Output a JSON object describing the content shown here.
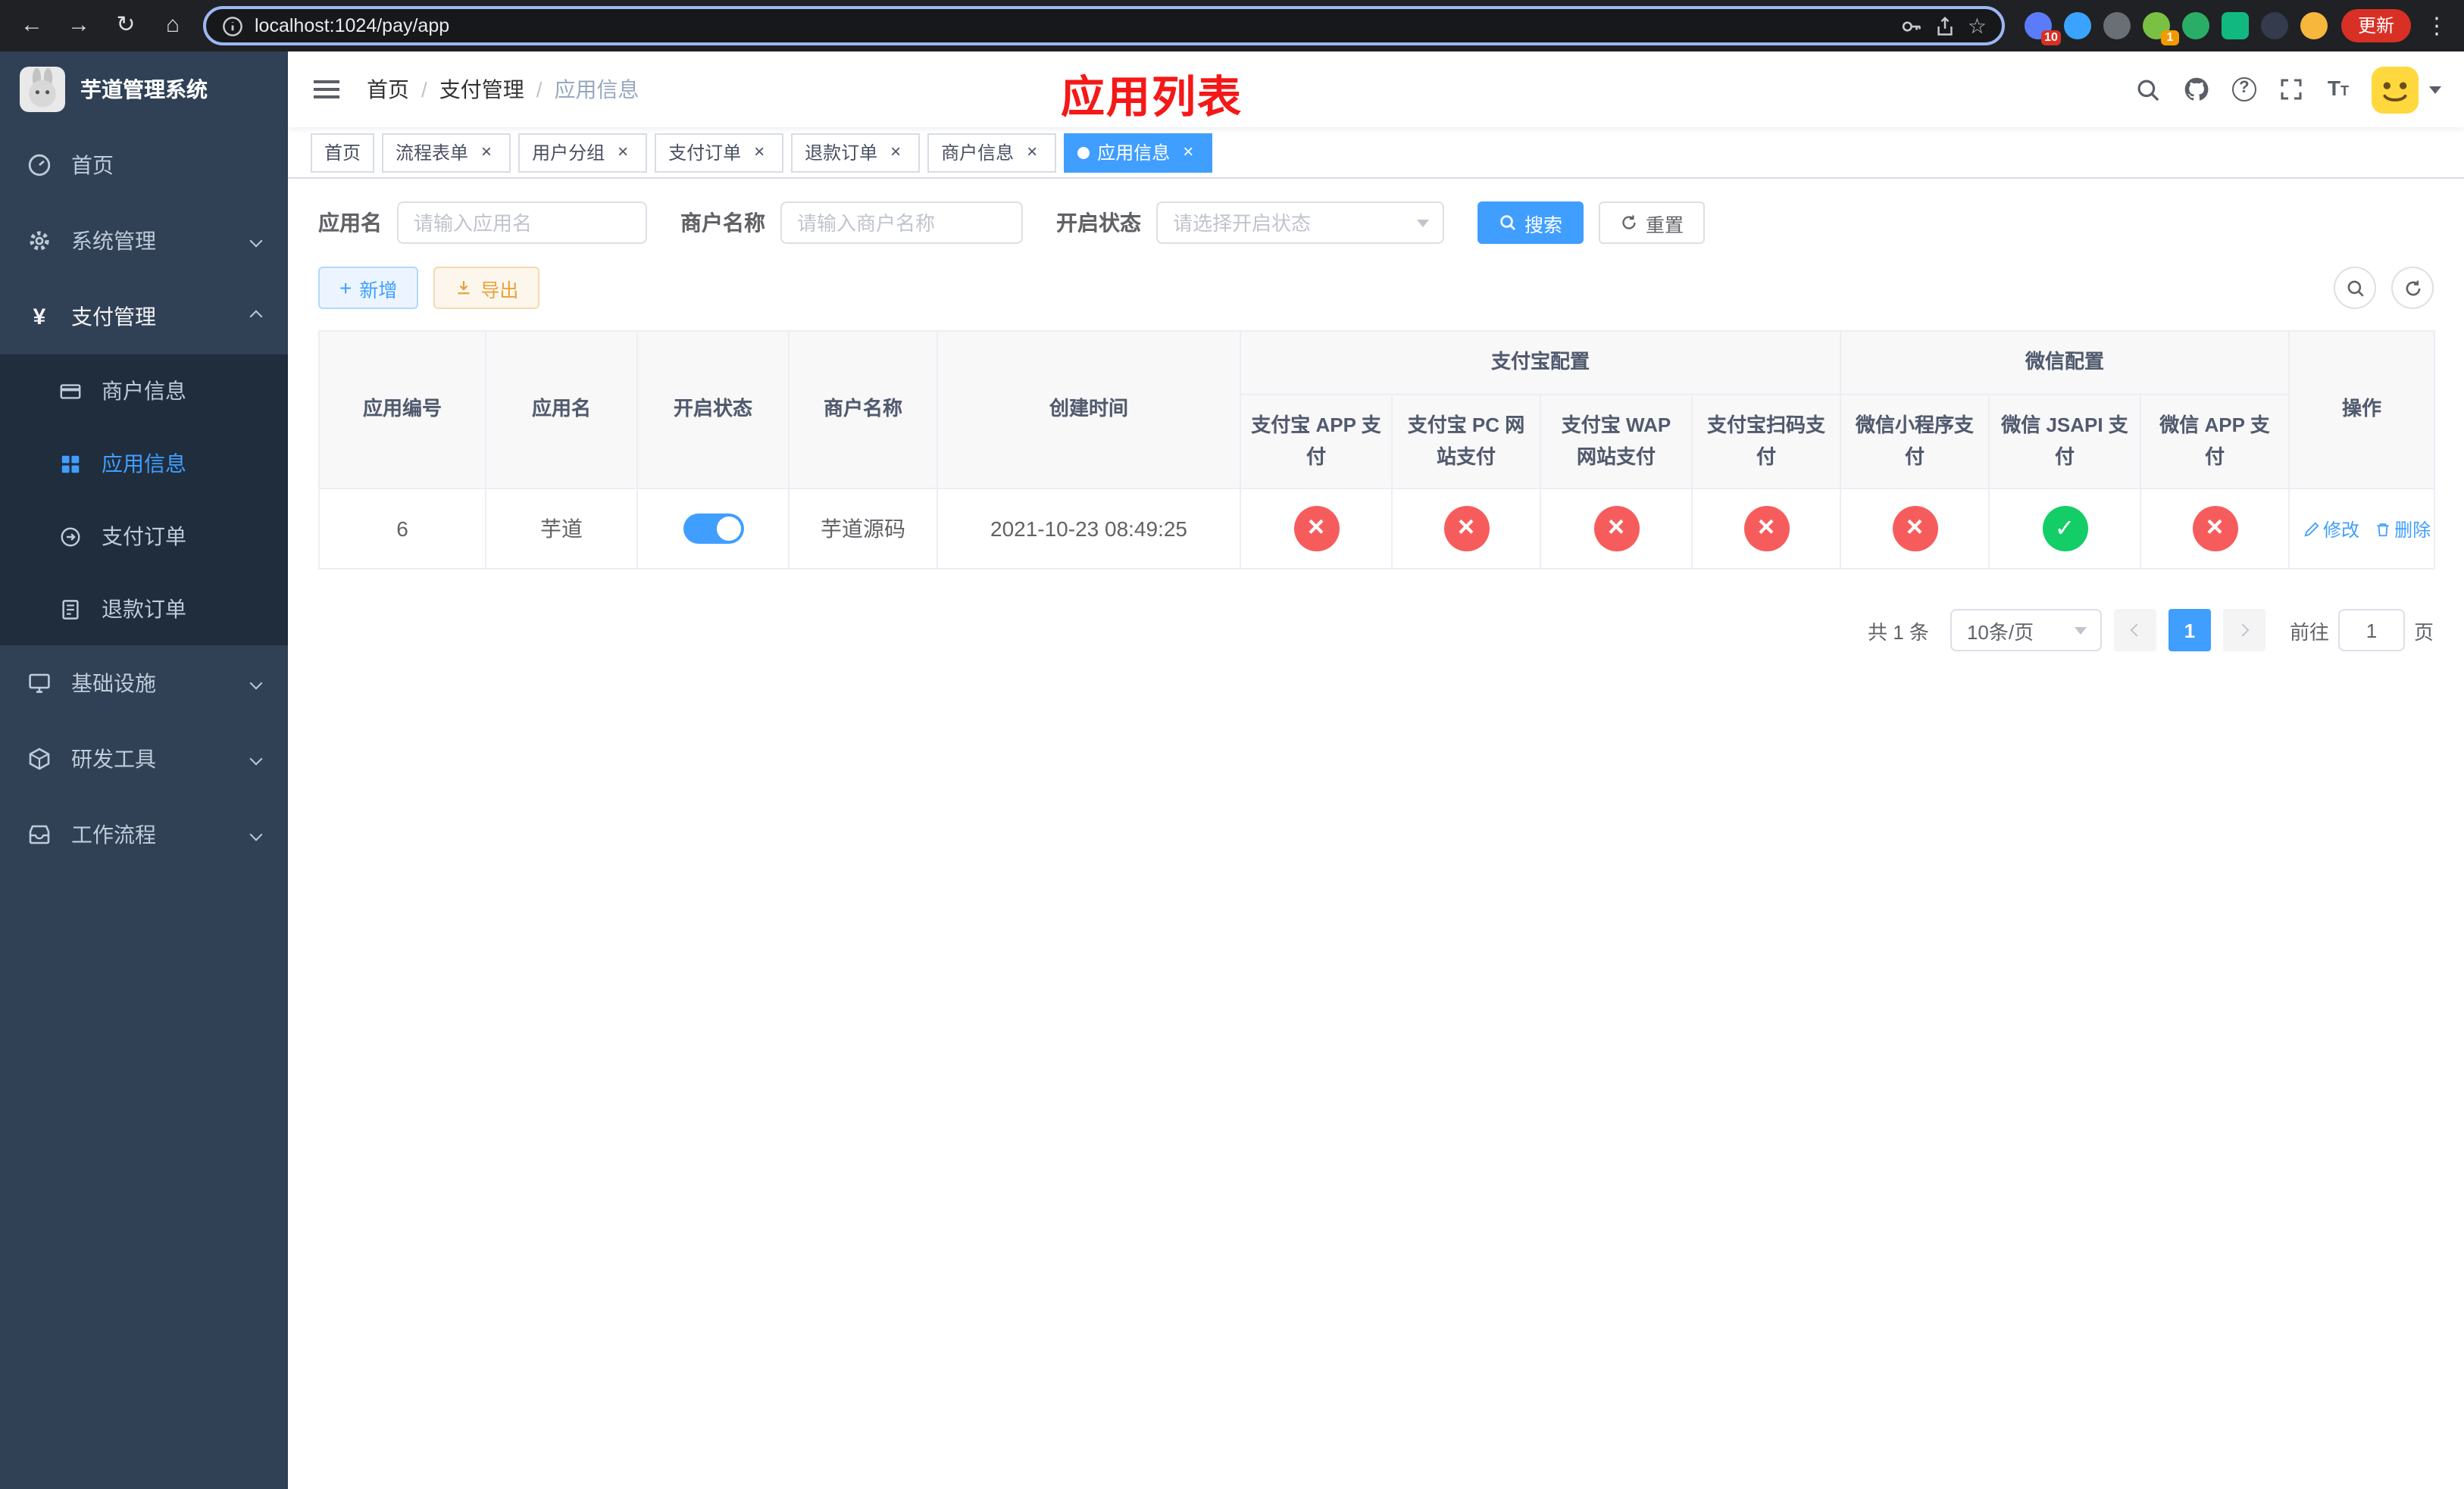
{
  "colors": {
    "accent": "#409eff",
    "success": "#13ce66",
    "danger": "#f75c5c",
    "sidebar_bg": "#304156",
    "submenu_bg": "#1f2d3d"
  },
  "browser": {
    "url": "localhost:1024/pay/app",
    "update_label": "更新",
    "ext_badge_1": "10",
    "ext_badge_2": "1"
  },
  "sidebar": {
    "title": "芋道管理系统",
    "items": [
      {
        "label": "首页"
      },
      {
        "label": "系统管理"
      },
      {
        "label": "支付管理"
      },
      {
        "label": "基础设施"
      },
      {
        "label": "研发工具"
      },
      {
        "label": "工作流程"
      }
    ],
    "submenu": [
      {
        "label": "商户信息"
      },
      {
        "label": "应用信息"
      },
      {
        "label": "支付订单"
      },
      {
        "label": "退款订单"
      }
    ]
  },
  "header": {
    "breadcrumb": [
      "首页",
      "支付管理",
      "应用信息"
    ],
    "separator": "/",
    "overlay_title": "应用列表"
  },
  "tabs": [
    {
      "label": "首页"
    },
    {
      "label": "流程表单"
    },
    {
      "label": "用户分组"
    },
    {
      "label": "支付订单"
    },
    {
      "label": "退款订单"
    },
    {
      "label": "商户信息"
    },
    {
      "label": "应用信息"
    }
  ],
  "filters": {
    "app_name_label": "应用名",
    "app_name_placeholder": "请输入应用名",
    "merchant_label": "商户名称",
    "merchant_placeholder": "请输入商户名称",
    "status_label": "开启状态",
    "status_placeholder": "请选择开启状态",
    "search_label": "搜索",
    "reset_label": "重置"
  },
  "toolbar": {
    "add_label": "新增",
    "export_label": "导出"
  },
  "table": {
    "base_columns": [
      "应用编号",
      "应用名",
      "开启状态",
      "商户名称",
      "创建时间"
    ],
    "group_alipay": {
      "label": "支付宝配置",
      "children": [
        "支付宝 APP 支付",
        "支付宝 PC 网站支付",
        "支付宝 WAP 网站支付",
        "支付宝扫码支付"
      ]
    },
    "group_wechat": {
      "label": "微信配置",
      "children": [
        "微信小程序支付",
        "微信 JSAPI 支付",
        "微信 APP 支付"
      ]
    },
    "actions_column": "操作",
    "rows": [
      {
        "id": "6",
        "name": "芋道",
        "enabled": true,
        "merchant": "芋道源码",
        "created_at": "2021-10-23 08:49:25",
        "configs": [
          false,
          false,
          false,
          false,
          false,
          true,
          false
        ],
        "edit_label": "修改",
        "delete_label": "删除"
      }
    ]
  },
  "pagination": {
    "total_text": "共 1 条",
    "page_size_text": "10条/页",
    "current_page": "1",
    "goto_prefix": "前往",
    "goto_value": "1",
    "goto_suffix": "页"
  }
}
